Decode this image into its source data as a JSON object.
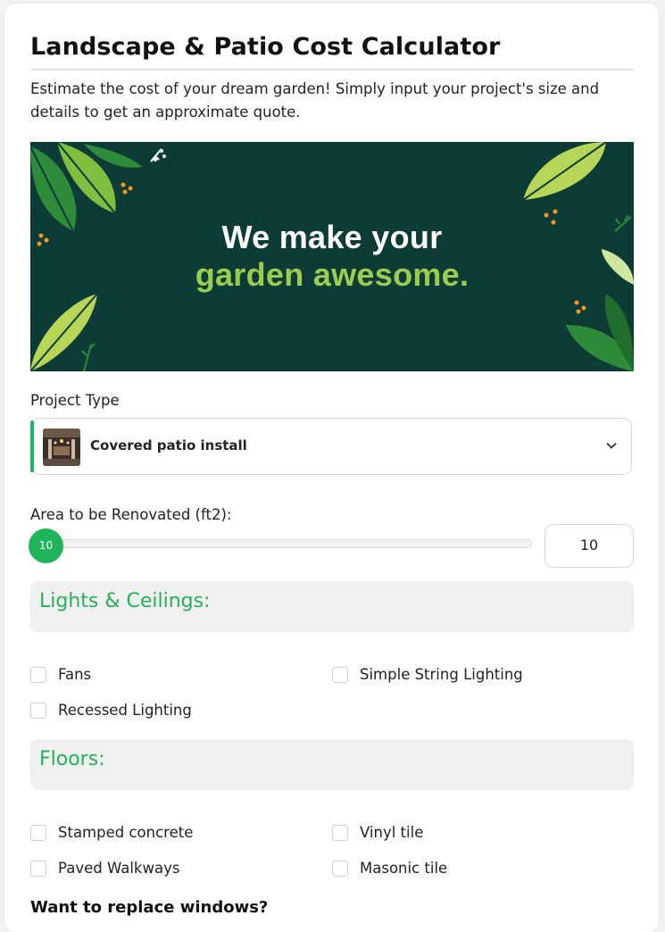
{
  "header": {
    "title": "Landscape & Patio Cost Calculator",
    "subtitle": "Estimate the cost of your dream garden! Simply input your project's size and details to get an approximate quote."
  },
  "banner": {
    "line1": "We make your",
    "line2": "garden awesome.",
    "colors": {
      "background": "#0d3b36",
      "accent": "#9ccc4e"
    }
  },
  "project_type": {
    "label": "Project Type",
    "selected": "Covered patio install",
    "icon": "chevron-down-icon"
  },
  "area": {
    "label": "Area to be Renovated (ft2):",
    "slider_value": "10",
    "input_value": "10"
  },
  "sections": {
    "lights": {
      "title": "Lights & Ceilings:",
      "options": [
        "Fans",
        "Simple String Lighting",
        "Recessed Lighting"
      ]
    },
    "floors": {
      "title": "Floors:",
      "options": [
        "Stamped concrete",
        "Vinyl tile",
        "Paved Walkways",
        "Masonic tile"
      ]
    }
  },
  "windows_question": "Want to replace windows?",
  "theme": {
    "accent": "#22b35b"
  }
}
